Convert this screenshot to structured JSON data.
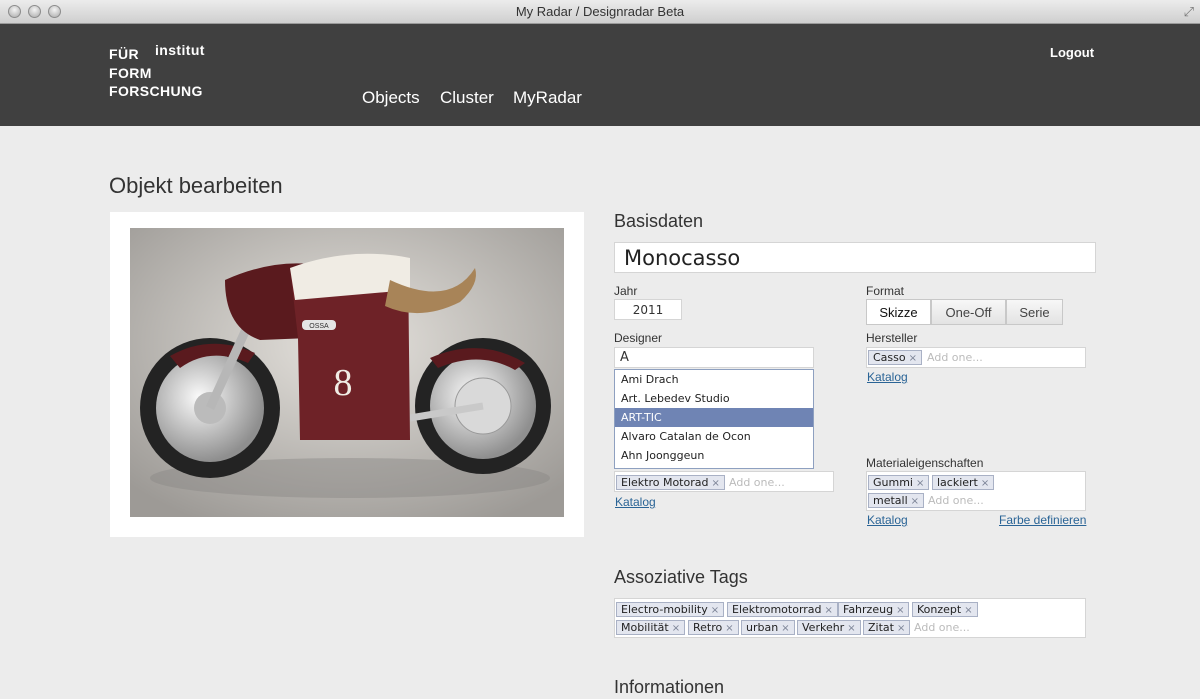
{
  "window": {
    "title": "My Radar / Designradar Beta"
  },
  "logo": {
    "line1": "FÜR",
    "line2": "FORM",
    "line3": "FORSCHUNG",
    "top": "institut"
  },
  "nav": {
    "objects": "Objects",
    "cluster": "Cluster",
    "myradar": "MyRadar",
    "logout": "Logout"
  },
  "page": {
    "title": "Objekt bearbeiten"
  },
  "basis": {
    "heading": "Basisdaten",
    "name": "Monocasso",
    "year_label": "Jahr",
    "year": "2011",
    "format_label": "Format",
    "formats": [
      "Skizze",
      "One-Off",
      "Serie"
    ],
    "designer_label": "Designer",
    "designer_value": "A",
    "suggestions": [
      "Ami Drach",
      "Art. Lebedev Studio",
      "ART-TIC",
      "Alvaro Catalan de Ocon",
      "Ahn Joonggeun"
    ],
    "hersteller_label": "Hersteller",
    "hersteller_tags": [
      "Casso"
    ],
    "katalog": "Katalog",
    "add_one": "Add one...",
    "category_tags": [
      "Elektro Motorad"
    ],
    "material_label": "Materialeigenschaften",
    "material_tags": [
      "Gummi",
      "lackiert",
      "metall"
    ],
    "farbe": "Farbe definieren"
  },
  "tags": {
    "heading": "Assoziative Tags",
    "items": [
      "Electro-mobility",
      "Elektromotorrad",
      "Fahrzeug",
      "Konzept",
      "Mobilität",
      "Retro",
      "urban",
      "Verkehr",
      "Zitat"
    ]
  },
  "info": {
    "heading": "Informationen"
  },
  "photo": {
    "plate": "OSSA",
    "number": "8"
  }
}
